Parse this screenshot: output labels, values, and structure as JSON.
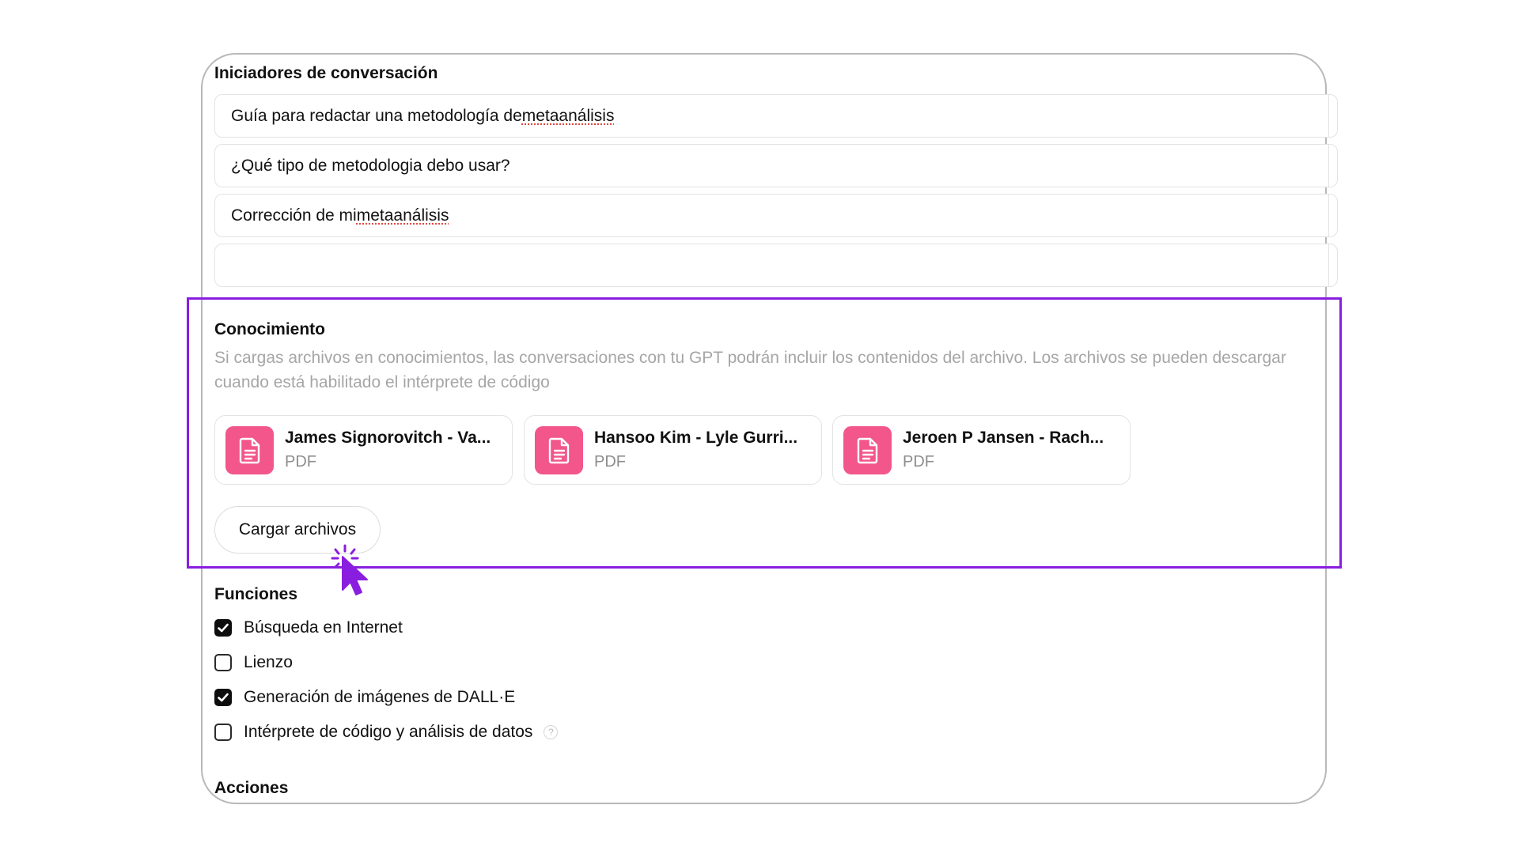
{
  "starters": {
    "title": "Iniciadores de conversación",
    "items": [
      {
        "before": "Guía para redactar una metodología de ",
        "flagged": "metaanálisis"
      },
      {
        "before": "¿Qué tipo de metodologia debo usar?",
        "flagged": ""
      },
      {
        "before": "Corrección de mi ",
        "flagged": "metaanálisis"
      },
      {
        "before": "",
        "flagged": ""
      }
    ]
  },
  "knowledge": {
    "title": "Conocimiento",
    "description": "Si cargas archivos en conocimientos, las conversaciones con tu GPT podrán incluir los contenidos del archivo. Los archivos se pueden descargar cuando está habilitado el intérprete de código",
    "files": [
      {
        "name": "James Signorovitch - Va...",
        "type": "PDF"
      },
      {
        "name": "Hansoo Kim - Lyle Gurri...",
        "type": "PDF"
      },
      {
        "name": "Jeroen P Jansen - Rach...",
        "type": "PDF"
      }
    ],
    "upload_label": "Cargar archivos"
  },
  "functions": {
    "title": "Funciones",
    "items": [
      {
        "label": "Búsqueda en Internet",
        "checked": true
      },
      {
        "label": "Lienzo",
        "checked": false
      },
      {
        "label": "Generación de imágenes de DALL·E",
        "checked": true
      },
      {
        "label": "Intérprete de código y análisis de datos",
        "checked": false
      }
    ],
    "help_glyph": "?"
  },
  "actions": {
    "title": "Acciones"
  },
  "colors": {
    "highlight": "#8a1ee0",
    "file_icon": "#f2568b",
    "checkbox_on": "#0d0d0d",
    "cursor": "#8a1ee0"
  }
}
